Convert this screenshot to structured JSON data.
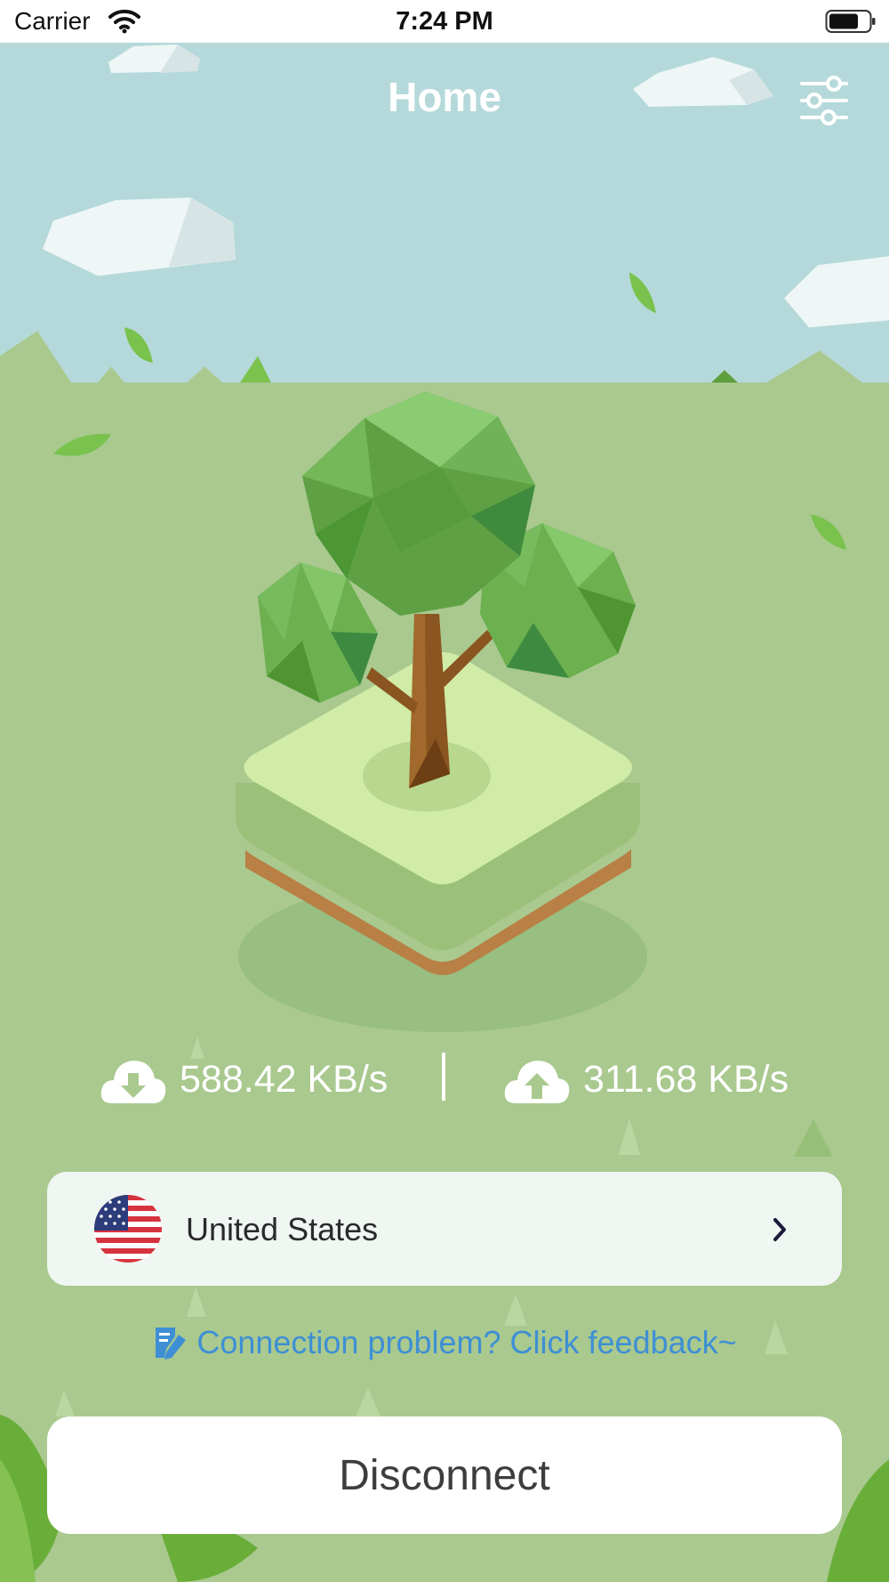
{
  "status_bar": {
    "carrier": "Carrier",
    "time": "7:24 PM"
  },
  "header": {
    "title": "Home",
    "settings_icon": "sliders-icon"
  },
  "speeds": {
    "download": "588.42 KB/s",
    "upload": "311.68 KB/s",
    "download_icon": "cloud-download-icon",
    "upload_icon": "cloud-upload-icon"
  },
  "server": {
    "name": "United States",
    "flag_icon": "us-flag-icon",
    "chevron_icon": "chevron-right-icon"
  },
  "feedback": {
    "text": "Connection problem? Click feedback~",
    "icon": "feedback-edit-icon"
  },
  "actions": {
    "disconnect_label": "Disconnect"
  },
  "colors": {
    "sky": "#b5d9da",
    "ground": "#a9c98f",
    "link": "#3e8fd4",
    "card": "#f0f6f2"
  }
}
